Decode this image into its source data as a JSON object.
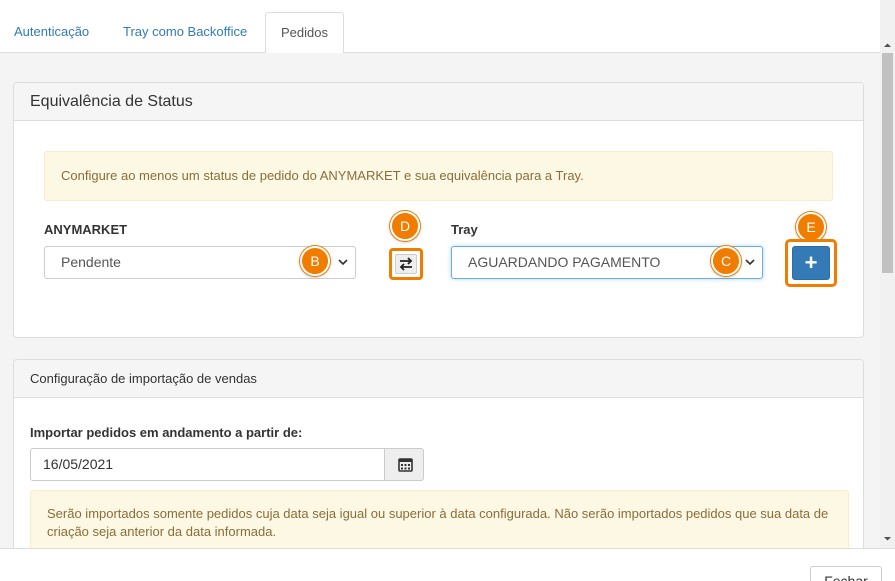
{
  "tabs": [
    {
      "label": "Autenticação",
      "active": false
    },
    {
      "label": "Tray como Backoffice",
      "active": false
    },
    {
      "label": "Pedidos",
      "active": true
    }
  ],
  "status_panel": {
    "title": "Equivalência de Status",
    "alert": "Configure ao menos um status de pedido do ANYMARKET e sua equivalência para a Tray.",
    "anymarket_label": "ANYMARKET",
    "anymarket_value": "Pendente",
    "tray_label": "Tray",
    "tray_value": "AGUARDANDO PAGAMENTO",
    "add_label": "+"
  },
  "badges": {
    "b": "B",
    "c": "C",
    "d": "D",
    "e": "E"
  },
  "import_panel": {
    "title": "Configuração de importação de vendas",
    "date_label": "Importar pedidos em andamento a partir de:",
    "date_value": "16/05/2021",
    "alert_line1": "Serão importados somente pedidos cuja data seja igual ou superior à data configurada. Não serão importados pedidos que sua data de",
    "alert_line2": "criação seja anterior da data informada."
  },
  "footer": {
    "close_label": "Fechar"
  },
  "colors": {
    "accent": "#f07c00",
    "primary": "#337ab7",
    "warning_bg": "#fcf8e3",
    "warning_text": "#8a6d3b"
  }
}
